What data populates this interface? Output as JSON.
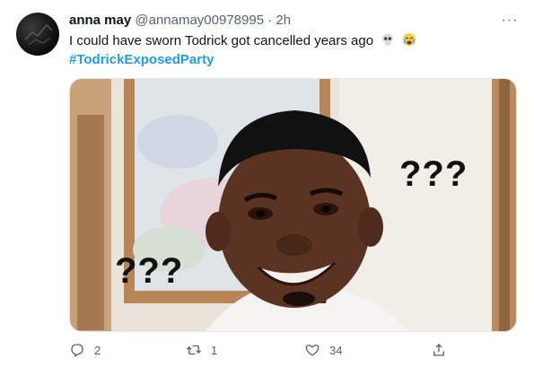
{
  "tweet": {
    "display_name": "anna may",
    "handle": "@annamay00978995",
    "separator": "·",
    "time": "2h",
    "text": "I could have sworn Todrick got cancelled years ago",
    "emojis": [
      "skull-emoji",
      "crying-face-emoji"
    ],
    "hashtag": "#TodrickExposedParty",
    "more_label": "···",
    "media": {
      "overlay_text_right": "???",
      "overlay_text_left": "???"
    }
  },
  "actions": {
    "reply_count": "2",
    "retweet_count": "1",
    "like_count": "34",
    "icons": [
      "reply-icon",
      "retweet-icon",
      "like-icon",
      "share-icon"
    ]
  },
  "colors": {
    "link": "#1d9bf0",
    "secondary_text": "#536471",
    "primary_text": "#0f1419"
  }
}
